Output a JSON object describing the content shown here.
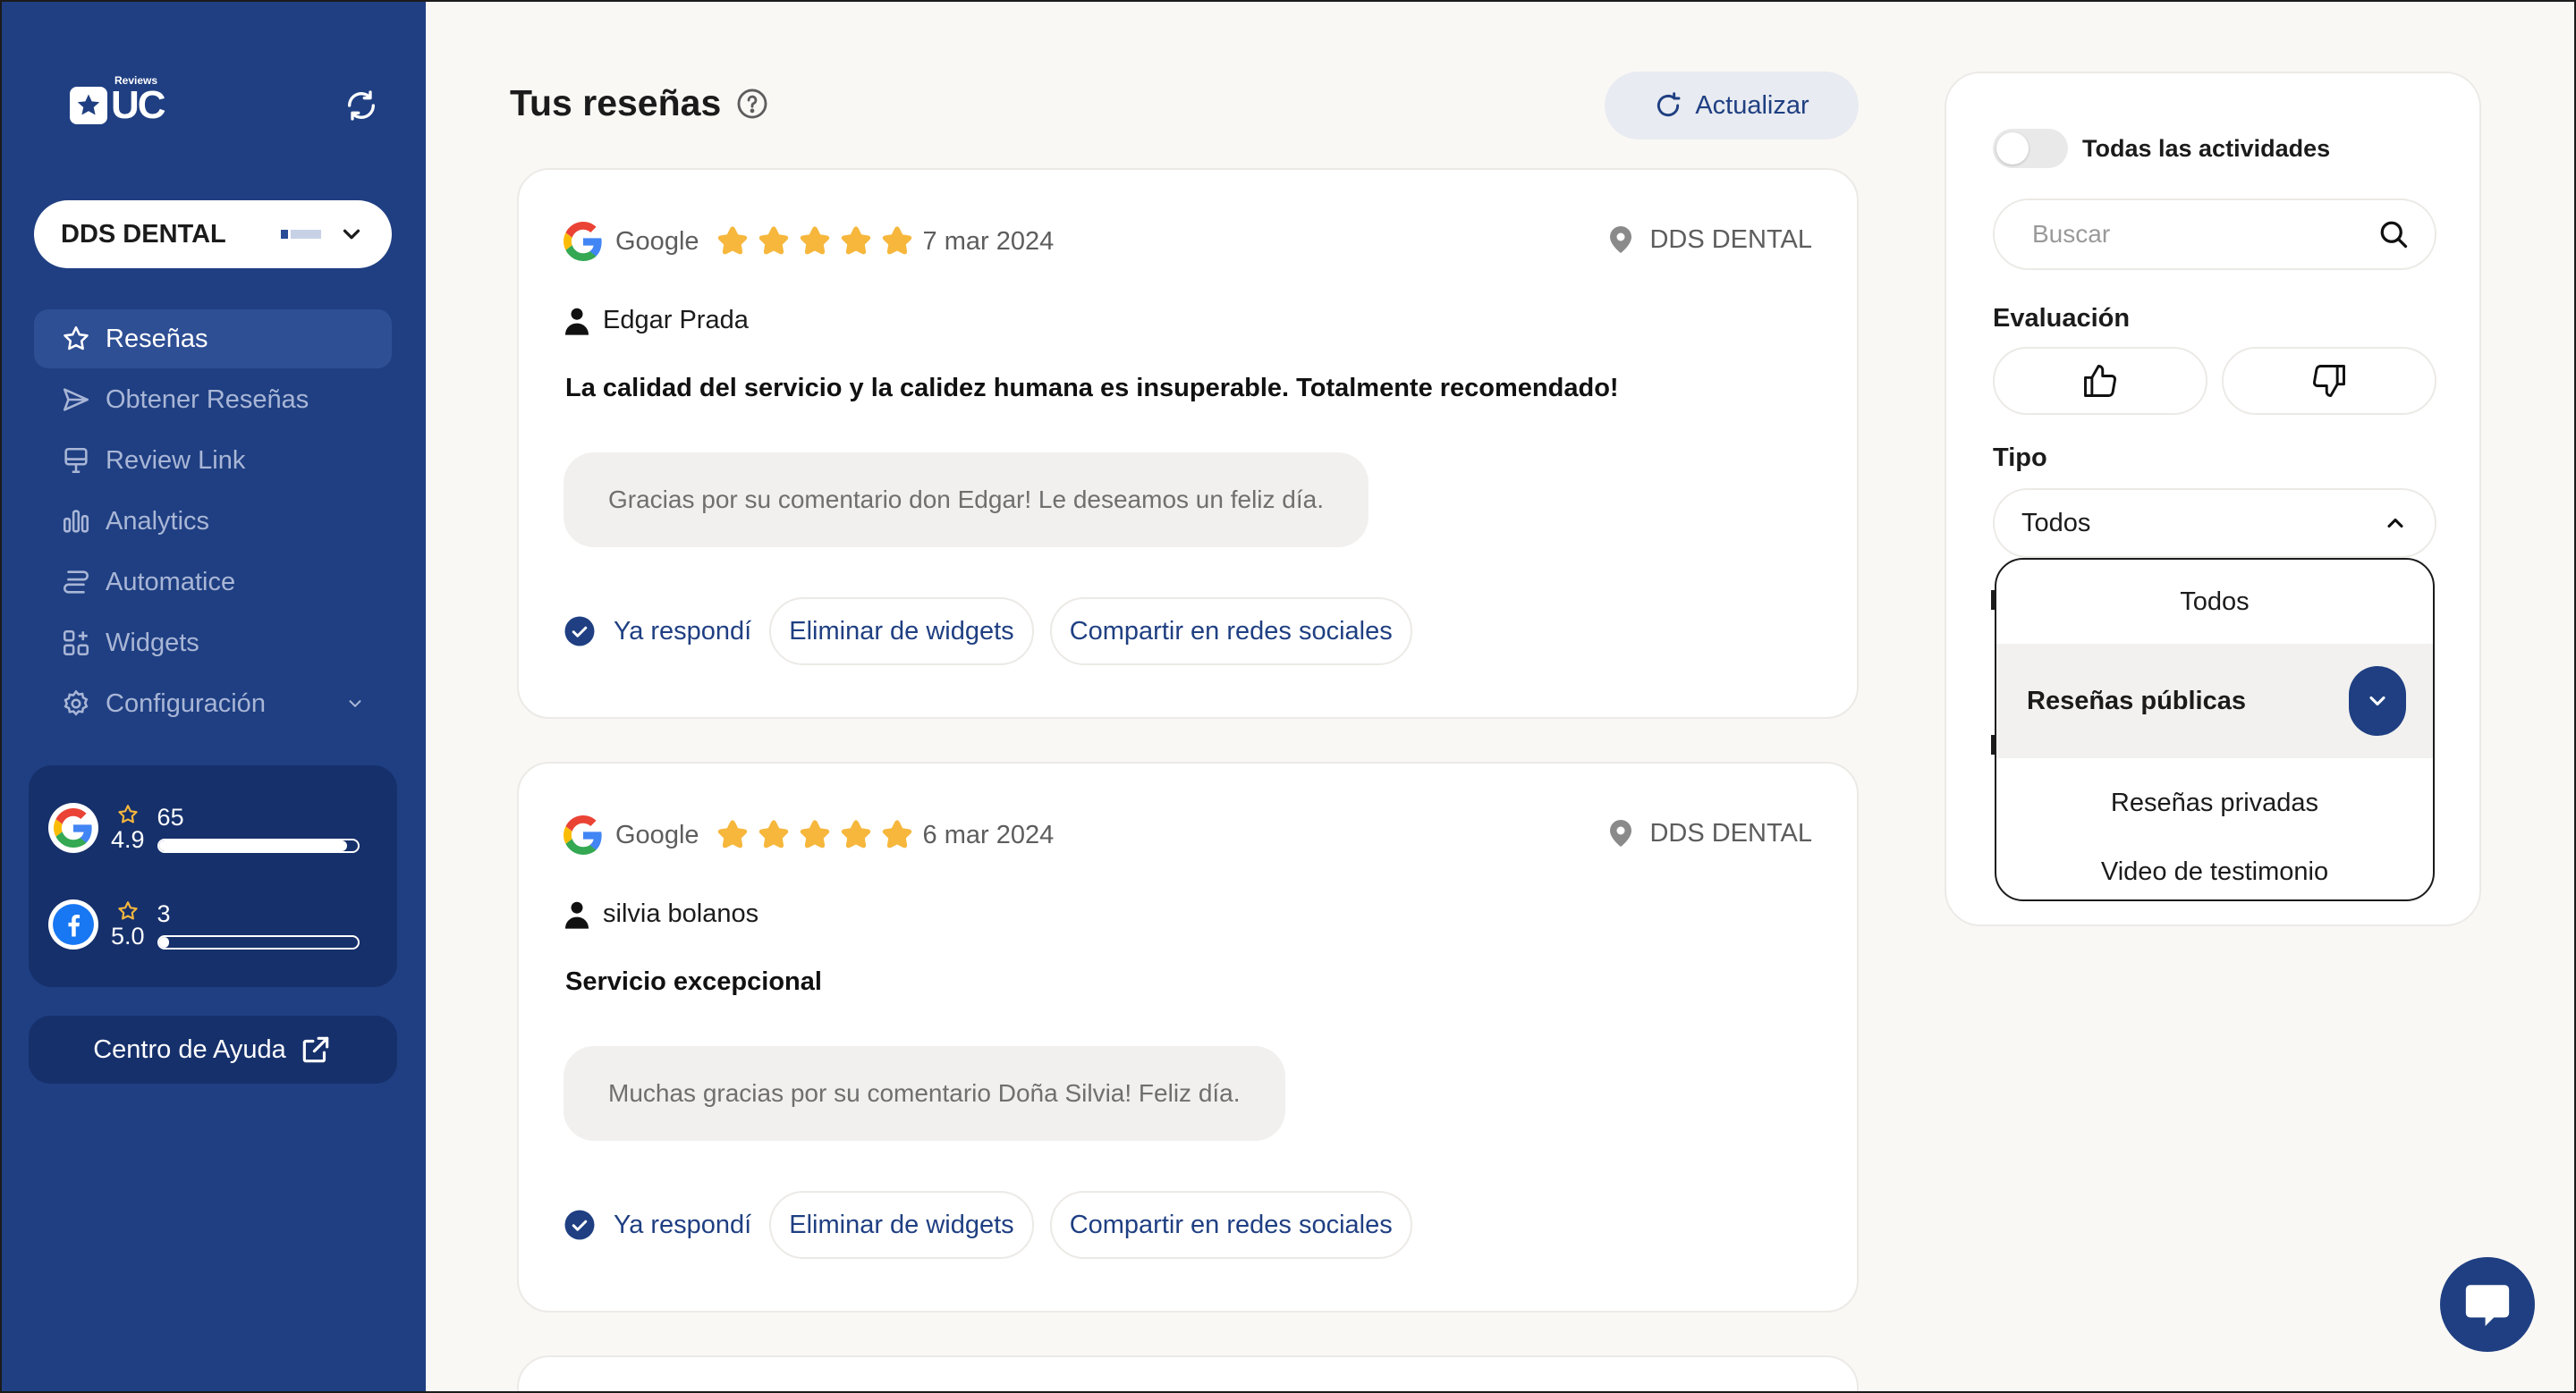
{
  "brand": {
    "logo_text": "UC",
    "logo_small": "Reviews"
  },
  "account": {
    "name": "DDS DENTAL"
  },
  "nav": {
    "items": [
      {
        "label": "Reseñas",
        "icon": "star-icon",
        "active": true
      },
      {
        "label": "Obtener Reseñas",
        "icon": "send-icon"
      },
      {
        "label": "Review Link",
        "icon": "monitor-icon"
      },
      {
        "label": "Analytics",
        "icon": "bar-chart-icon"
      },
      {
        "label": "Automatice",
        "icon": "automation-icon"
      },
      {
        "label": "Widgets",
        "icon": "widgets-icon"
      },
      {
        "label": "Configuración",
        "icon": "gear-icon"
      }
    ]
  },
  "ratings": [
    {
      "source": "Google",
      "score": "4.9",
      "count": "65",
      "fill_fraction": 0.95
    },
    {
      "source": "Facebook",
      "score": "5.0",
      "count": "3",
      "fill_fraction": 0.05
    }
  ],
  "help": {
    "label": "Centro de Ayuda"
  },
  "header": {
    "title": "Tus reseñas",
    "refresh_label": "Actualizar"
  },
  "reviews": [
    {
      "source": "Google",
      "rating": 5,
      "date": "7 mar 2024",
      "location": "DDS DENTAL",
      "author": "Edgar Prada",
      "text": "La calidad del servicio y la calidez humana es insuperable. Totalmente recomendado!",
      "reply": "Gracias por su comentario don Edgar! Le deseamos un feliz día.",
      "replied_label": "Ya respondí",
      "remove_widgets_label": "Eliminar de widgets",
      "share_label": "Compartir en redes sociales"
    },
    {
      "source": "Google",
      "rating": 5,
      "date": "6 mar 2024",
      "location": "DDS DENTAL",
      "author": "silvia bolanos",
      "text": "Servicio excepcional",
      "reply": "Muchas gracias por su comentario Doña Silvia! Feliz día.",
      "replied_label": "Ya respondí",
      "remove_widgets_label": "Eliminar de widgets",
      "share_label": "Compartir en redes sociales"
    }
  ],
  "filters": {
    "all_activities_label": "Todas las actividades",
    "search_placeholder": "Buscar",
    "evaluation_label": "Evaluación",
    "type_label": "Tipo",
    "type_selected": "Todos",
    "type_options": [
      "Todos",
      "Reseñas públicas",
      "Reseñas privadas",
      "Video de testimonio"
    ],
    "highlighted_option": "Reseñas públicas"
  },
  "colors": {
    "sidebar": "#1f3f82",
    "accent": "#1f3f82",
    "star": "#f6b73c"
  }
}
